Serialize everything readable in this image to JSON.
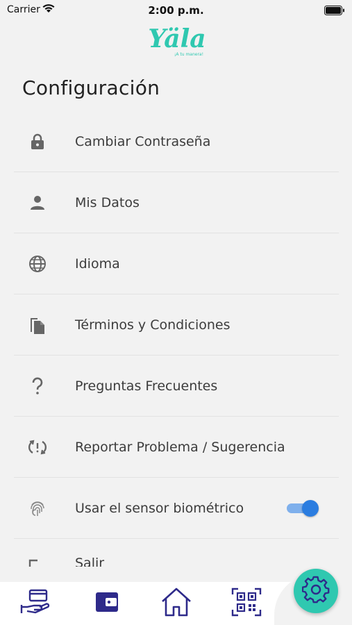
{
  "status_bar": {
    "carrier": "Carrier",
    "time": "2:00 p.m."
  },
  "brand": {
    "logo_text": "Yäla",
    "tagline": "¡A tu manera!"
  },
  "page": {
    "title": "Configuración"
  },
  "settings": {
    "items": [
      {
        "label": "Cambiar Contraseña",
        "icon": "lock-icon"
      },
      {
        "label": "Mis Datos",
        "icon": "person-icon"
      },
      {
        "label": "Idioma",
        "icon": "globe-icon"
      },
      {
        "label": "Términos y Condiciones",
        "icon": "documents-icon"
      },
      {
        "label": "Preguntas Frecuentes",
        "icon": "question-icon"
      },
      {
        "label": "Reportar Problema / Sugerencia",
        "icon": "feedback-icon"
      },
      {
        "label": "Usar el sensor biométrico",
        "icon": "fingerprint-icon",
        "toggle_on": true
      },
      {
        "label": "Salir",
        "icon": "logout-icon"
      }
    ]
  },
  "bottom_nav": {
    "items": [
      {
        "icon": "card-hand-icon"
      },
      {
        "icon": "wallet-icon"
      },
      {
        "icon": "home-icon"
      },
      {
        "icon": "qr-code-icon"
      },
      {
        "icon": "gear-icon",
        "active": true
      }
    ]
  },
  "colors": {
    "accent": "#2fc8b0",
    "nav_icon": "#2e2a8a",
    "toggle": "#2b7de0",
    "background": "#f2f2f2"
  }
}
